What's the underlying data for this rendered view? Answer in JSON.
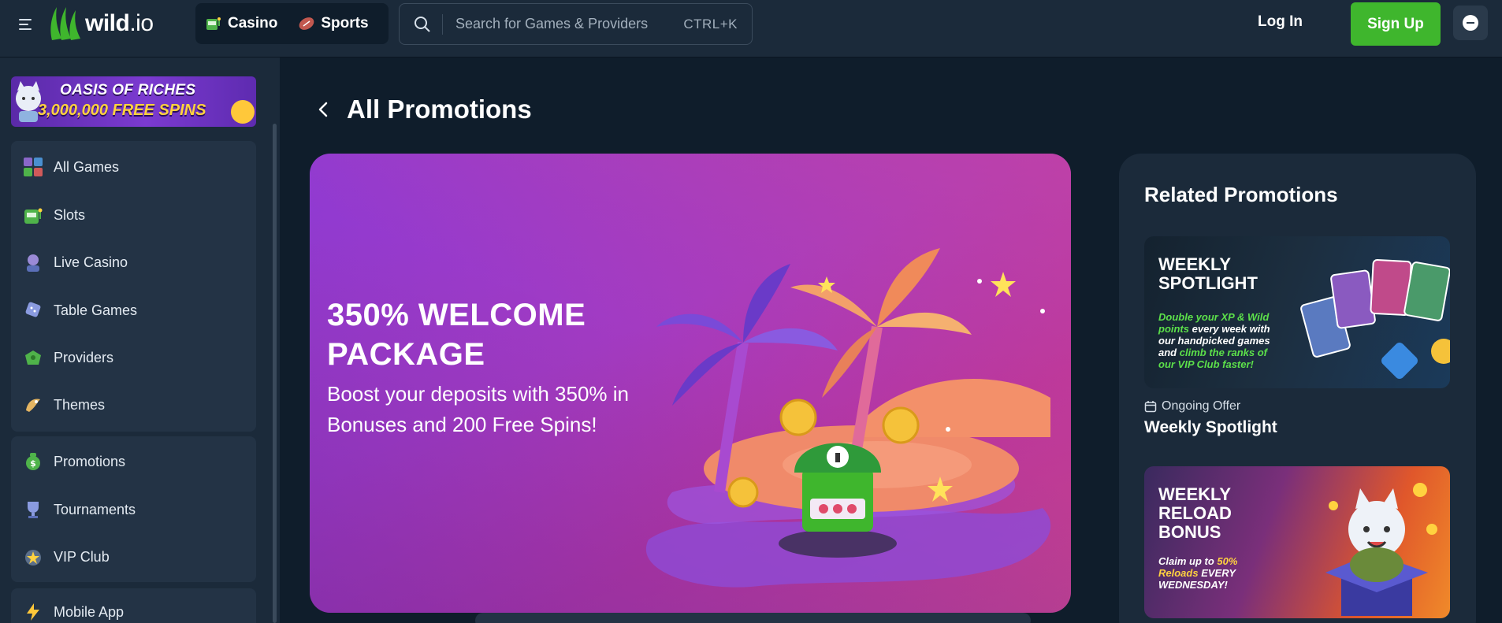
{
  "header": {
    "logo_text": "wild",
    "logo_suffix": ".io",
    "nav": [
      {
        "label": "Casino",
        "icon": "slot-machine-icon"
      },
      {
        "label": "Sports",
        "icon": "football-icon"
      }
    ],
    "search": {
      "placeholder": "Search for Games & Providers",
      "shortcut": "CTRL+K"
    },
    "login_label": "Log In",
    "signup_label": "Sign Up",
    "accent_green": "#3fb62d"
  },
  "sidebar": {
    "banner": {
      "line1": "OASIS OF RICHES",
      "line2": "3,000,000 FREE SPINS"
    },
    "groups": [
      [
        {
          "label": "All Games",
          "icon": "grid-icon"
        },
        {
          "label": "Slots",
          "icon": "slot-machine-icon"
        },
        {
          "label": "Live Casino",
          "icon": "dealer-icon"
        },
        {
          "label": "Table Games",
          "icon": "dice-icon"
        },
        {
          "label": "Providers",
          "icon": "controller-icon"
        },
        {
          "label": "Themes",
          "icon": "theme-icon"
        }
      ],
      [
        {
          "label": "Promotions",
          "icon": "money-bag-icon"
        },
        {
          "label": "Tournaments",
          "icon": "trophy-icon"
        },
        {
          "label": "VIP Club",
          "icon": "crown-icon"
        }
      ],
      [
        {
          "label": "Mobile App",
          "icon": "lightning-icon"
        }
      ]
    ]
  },
  "main": {
    "title": "All Promotions",
    "hero": {
      "headline": "350% WELCOME PACKAGE",
      "subtext": "Boost your deposits with 350% in Bonuses and 200 Free Spins!"
    }
  },
  "related": {
    "heading": "Related Promotions",
    "cards": [
      {
        "banner_title": "WEEKLY SPOTLIGHT",
        "banner_desc_1": "Double your",
        "banner_desc_2": "XP & Wild points",
        "banner_desc_3": "every week with our handpicked games and",
        "banner_desc_4": "climb the ranks of our VIP Club faster!",
        "meta": "Ongoing Offer",
        "title": "Weekly Spotlight"
      },
      {
        "banner_title": "WEEKLY RELOAD BONUS",
        "banner_desc_1": "Claim up to",
        "banner_desc_2": "50% Reloads",
        "banner_desc_3": "EVERY WEDNESDAY!"
      }
    ]
  }
}
